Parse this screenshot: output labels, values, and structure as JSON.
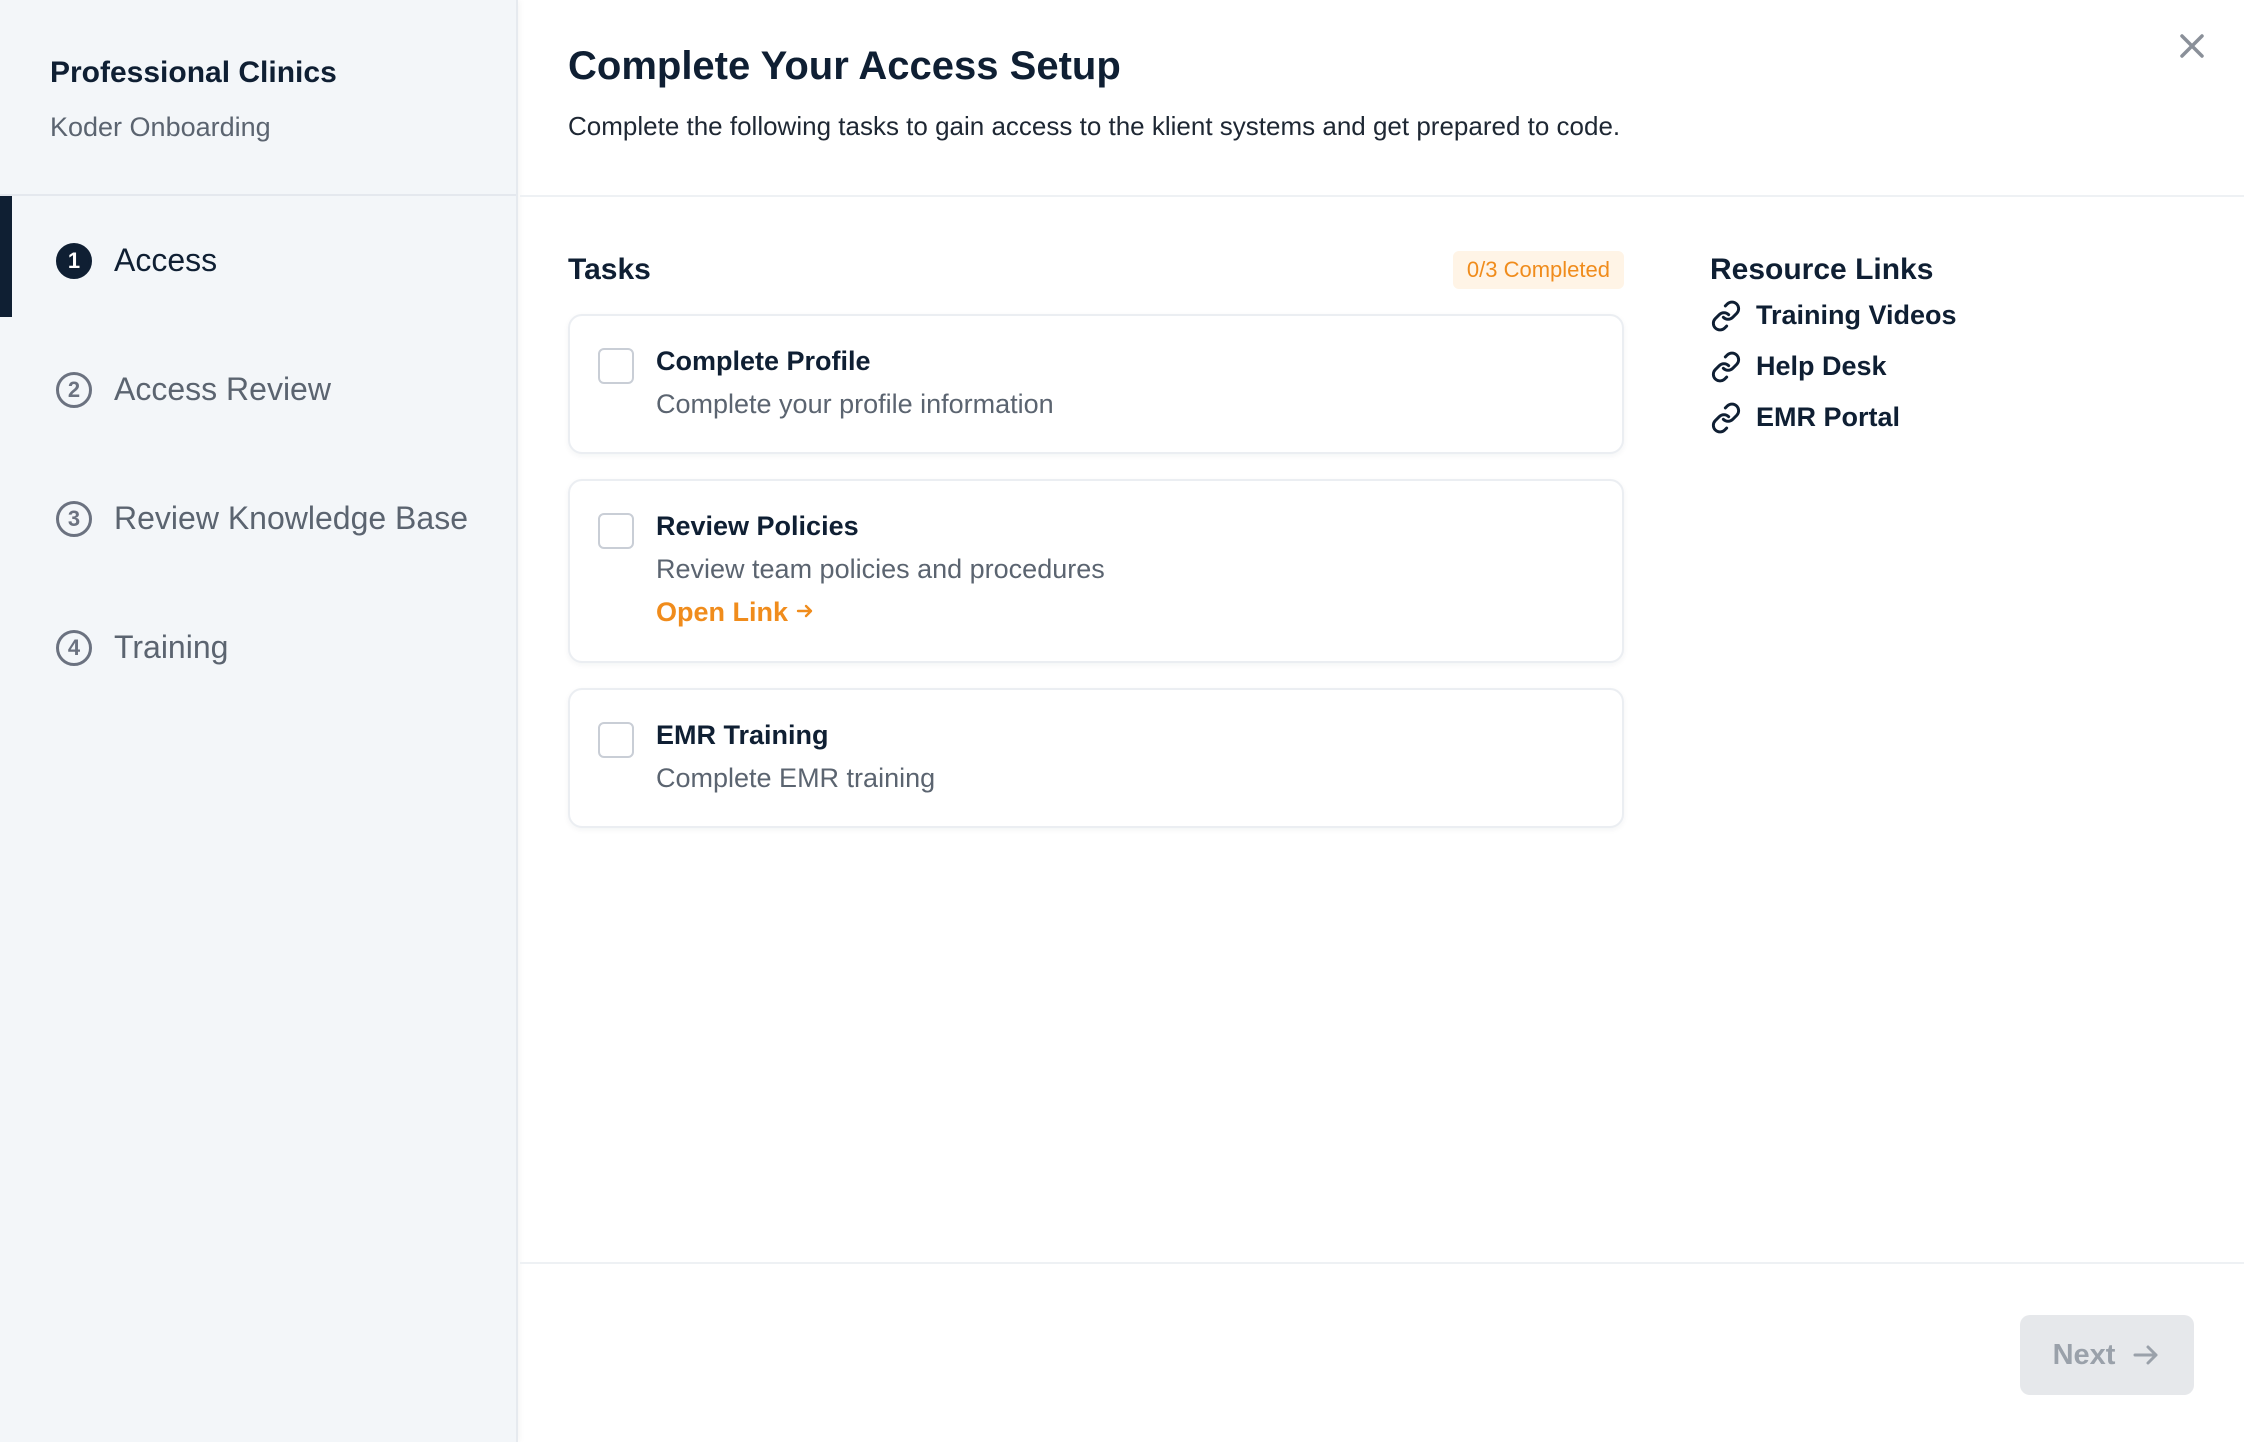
{
  "sidebar": {
    "org_name": "Professional Clinics",
    "org_subtitle": "Koder Onboarding",
    "steps": [
      {
        "num": "1",
        "label": "Access",
        "active": true
      },
      {
        "num": "2",
        "label": "Access Review",
        "active": false
      },
      {
        "num": "3",
        "label": "Review Knowledge Base",
        "active": false
      },
      {
        "num": "4",
        "label": "Training",
        "active": false
      }
    ]
  },
  "header": {
    "title": "Complete Your Access Setup",
    "description": "Complete the following tasks to gain access to the klient systems and get prepared to code."
  },
  "tasks": {
    "title": "Tasks",
    "badge": "0/3 Completed",
    "items": [
      {
        "title": "Complete Profile",
        "description": "Complete your profile information",
        "checked": false
      },
      {
        "title": "Review Policies",
        "description": "Review team policies and procedures",
        "link": "Open Link",
        "checked": false
      },
      {
        "title": "EMR Training",
        "description": "Complete EMR training",
        "checked": false
      }
    ]
  },
  "resources": {
    "title": "Resource Links",
    "items": [
      {
        "label": "Training Videos",
        "icon": "link-icon"
      },
      {
        "label": "Help Desk",
        "icon": "link-icon"
      },
      {
        "label": "EMR Portal",
        "icon": "link-icon"
      }
    ]
  },
  "footer": {
    "next_label": "Next"
  },
  "colors": {
    "accent": "#f08c1c",
    "primary": "#0f1f33",
    "sidebar_bg": "#f3f6f9"
  }
}
